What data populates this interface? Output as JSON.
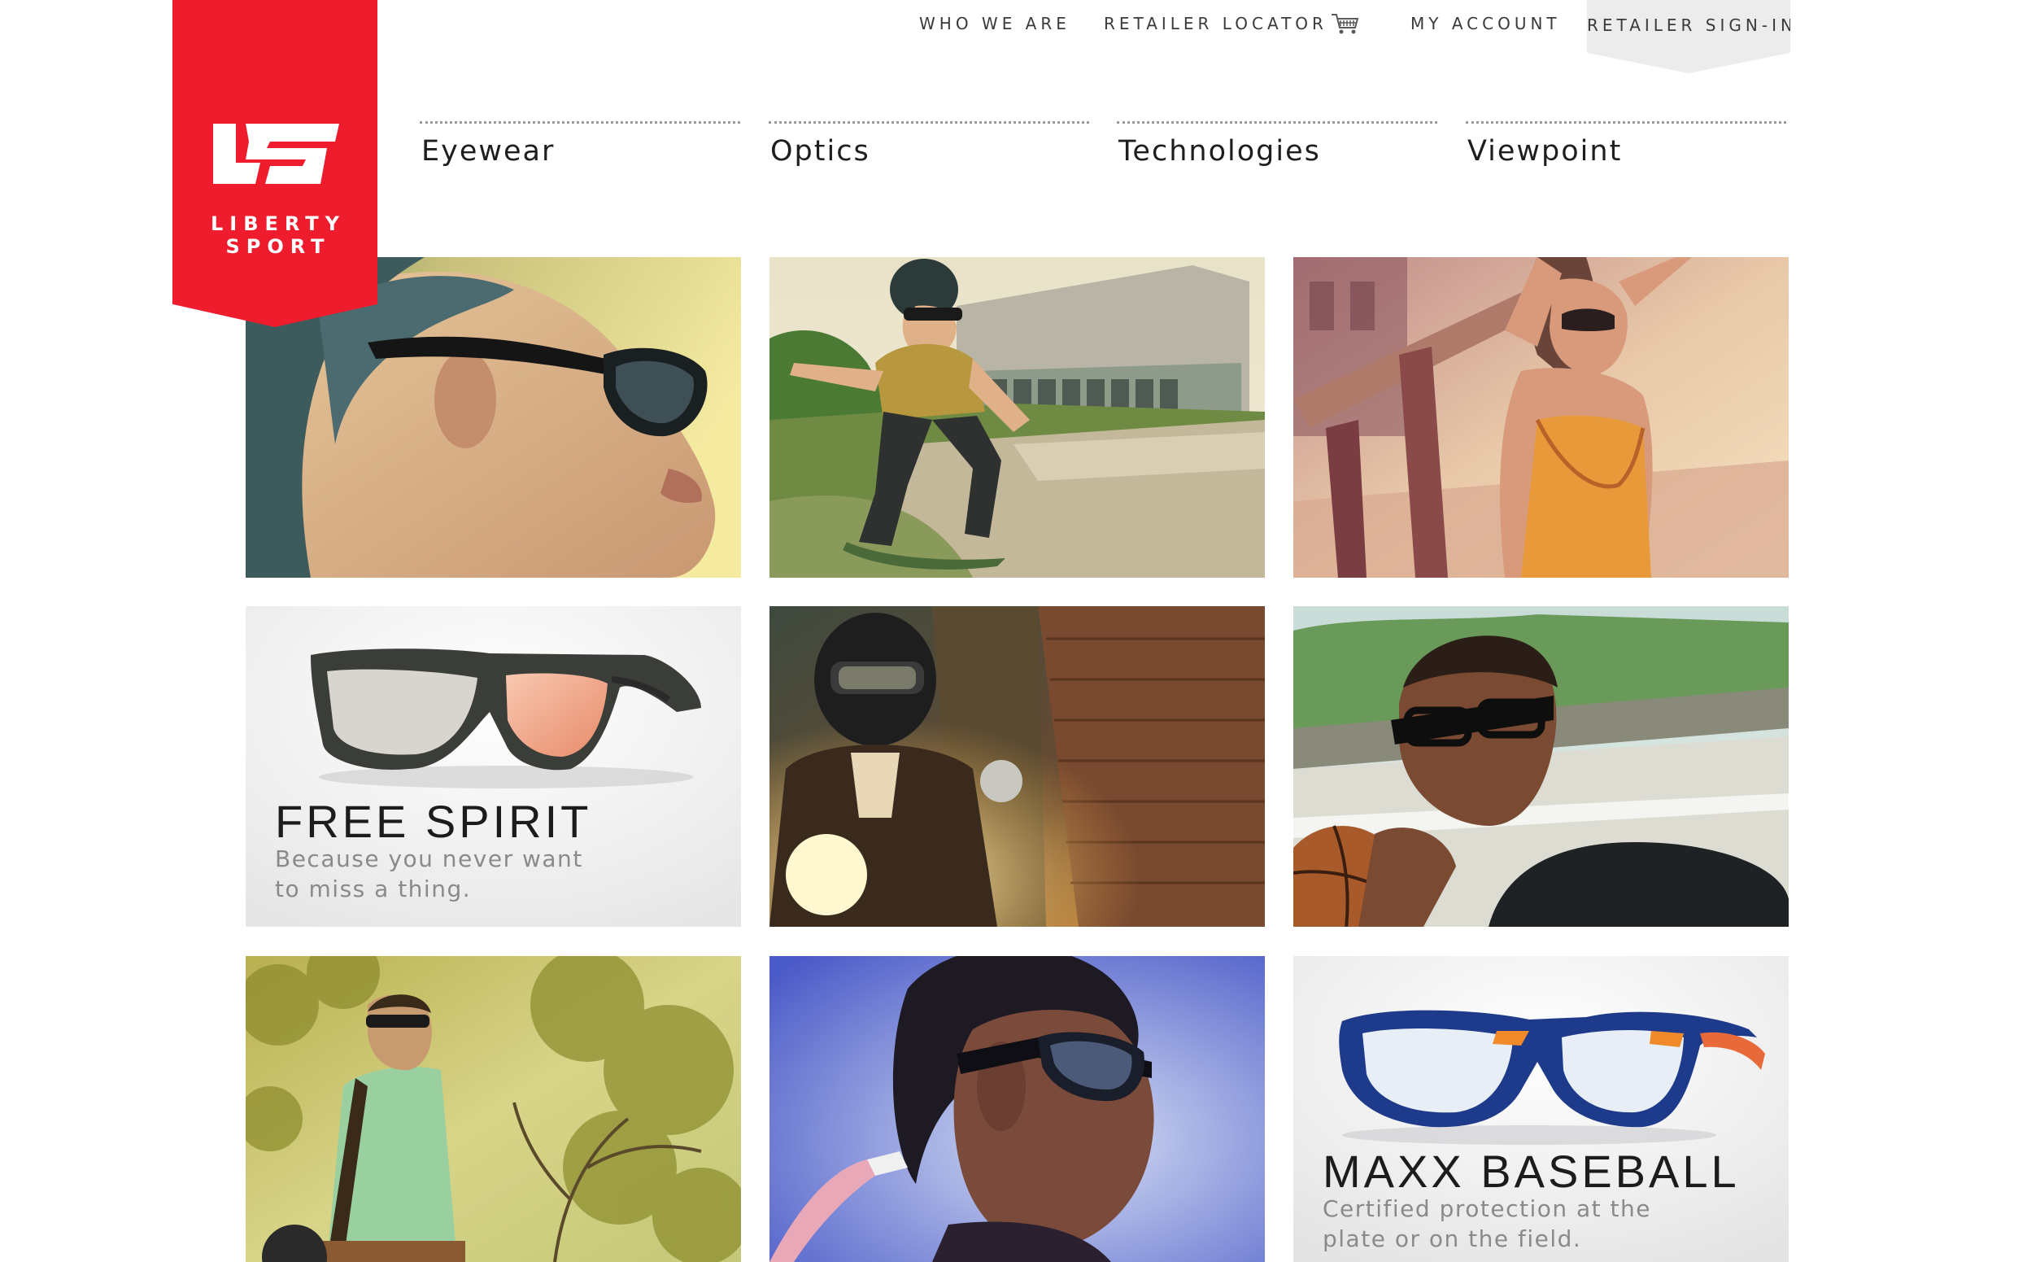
{
  "brand": {
    "name_line1": "LIBERTY",
    "name_line2": "SPORT",
    "color": "#ee1c2d"
  },
  "utility_nav": {
    "who_we_are": "WHO WE ARE",
    "retailer_locator": "RETAILER LOCATOR",
    "cart_icon": "shopping-cart-icon",
    "my_account": "MY ACCOUNT",
    "retailer_sign_in": "RETAILER SIGN-IN"
  },
  "main_nav": {
    "items": [
      {
        "label": "Eyewear"
      },
      {
        "label": "Optics"
      },
      {
        "label": "Technologies"
      },
      {
        "label": "Viewpoint"
      }
    ]
  },
  "tiles": [
    {
      "kind": "photo",
      "subject": "woman in profile wearing wraparound sport sunglasses"
    },
    {
      "kind": "photo",
      "subject": "young skateboarder wearing helmet and protective eyewear"
    },
    {
      "kind": "photo",
      "subject": "woman in orange top wearing sunglasses"
    },
    {
      "kind": "promo",
      "title": "FREE SPIRIT",
      "subtitle": "Because you never want to miss a thing."
    },
    {
      "kind": "photo",
      "subject": "motorcycle rider wearing helmet and goggles"
    },
    {
      "kind": "photo",
      "subject": "basketball player wearing protective sport goggles"
    },
    {
      "kind": "photo",
      "subject": "man in green polo wearing sunglasses carrying golf bag"
    },
    {
      "kind": "photo",
      "subject": "woman wearing wraparound sport eyewear"
    },
    {
      "kind": "promo",
      "title": "MAXX BASEBALL",
      "subtitle": "Certified protection at the plate or on the field."
    }
  ]
}
